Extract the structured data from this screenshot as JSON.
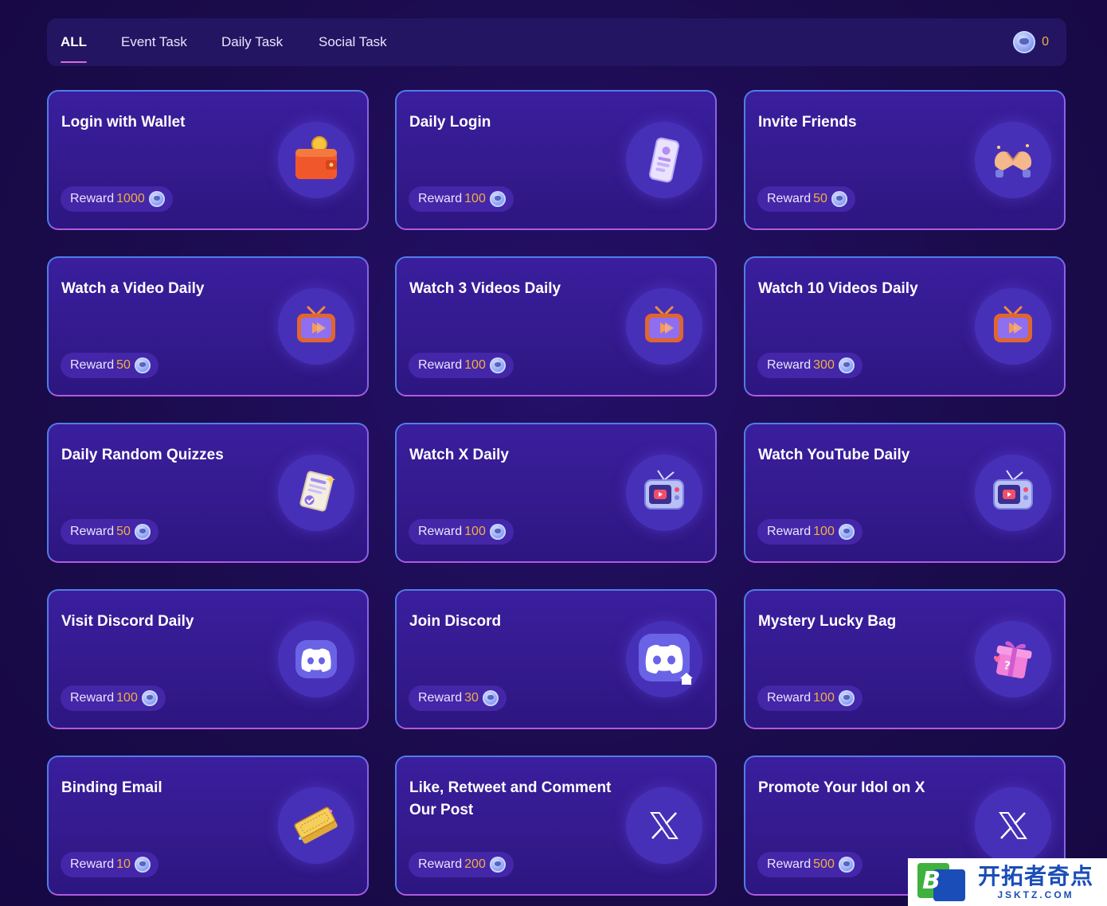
{
  "tabs": [
    {
      "label": "ALL",
      "active": true
    },
    {
      "label": "Event Task",
      "active": false
    },
    {
      "label": "Daily Task",
      "active": false
    },
    {
      "label": "Social Task",
      "active": false
    }
  ],
  "balance": {
    "value": "0",
    "icon": "coin-icon"
  },
  "reward_label": "Reward",
  "colors": {
    "background": "#1a0b4a",
    "card": "#331a8c",
    "accent_amount": "#f0b040",
    "active_tab_underline": "#d86bd9"
  },
  "tasks": [
    {
      "title": "Login with Wallet",
      "reward": "1000",
      "icon": "wallet-icon"
    },
    {
      "title": "Daily Login",
      "reward": "100",
      "icon": "phone-icon"
    },
    {
      "title": "Invite Friends",
      "reward": "50",
      "icon": "heart-hands-icon"
    },
    {
      "title": "Watch a Video Daily",
      "reward": "50",
      "icon": "tv-play-icon"
    },
    {
      "title": "Watch 3 Videos Daily",
      "reward": "100",
      "icon": "tv-play-icon"
    },
    {
      "title": "Watch 10 Videos Daily",
      "reward": "300",
      "icon": "tv-play-icon"
    },
    {
      "title": "Daily Random Quizzes",
      "reward": "50",
      "icon": "quiz-paper-icon"
    },
    {
      "title": "Watch X Daily",
      "reward": "100",
      "icon": "retro-tv-icon"
    },
    {
      "title": "Watch YouTube Daily",
      "reward": "100",
      "icon": "retro-tv-icon"
    },
    {
      "title": "Visit Discord Daily",
      "reward": "100",
      "icon": "discord-icon"
    },
    {
      "title": "Join Discord",
      "reward": "30",
      "icon": "discord-home-icon"
    },
    {
      "title": "Mystery Lucky Bag",
      "reward": "100",
      "icon": "gift-box-icon"
    },
    {
      "title": "Binding Email",
      "reward": "10",
      "icon": "ticket-icon"
    },
    {
      "title": "Like, Retweet and Comment Our Post",
      "reward": "200",
      "icon": "x-logo-icon"
    },
    {
      "title": "Promote Your Idol on X",
      "reward": "500",
      "icon": "x-logo-icon"
    }
  ],
  "watermark": {
    "main": "开拓者奇点",
    "sub": "JSKTZ.COM",
    "logo_letter": "B"
  }
}
